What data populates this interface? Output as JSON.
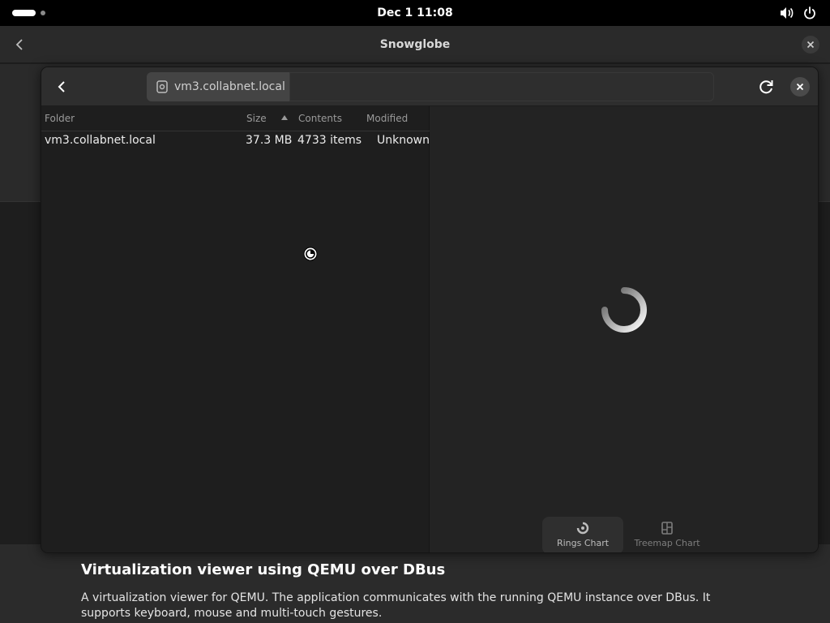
{
  "topbar": {
    "clock": "Dec 1  11:08",
    "icons": [
      "activities-pill",
      "workspace-dot",
      "volume-icon",
      "power-icon"
    ]
  },
  "background_app": {
    "title": "Snowglobe",
    "heading": "Virtualization viewer using QEMU over DBus",
    "description": "A virtualization viewer for QEMU. The application communicates with the running QEMU instance over DBus. It supports keyboard, mouse and multi-touch gestures."
  },
  "window": {
    "path": {
      "crumb_label": "vm3.collabnet.local",
      "icon": "drive-icon"
    },
    "columns": {
      "folder": "Folder",
      "size": "Size",
      "contents": "Contents",
      "modified": "Modified"
    },
    "rows": [
      {
        "folder": "vm3.collabnet.local",
        "size": "37.3 MB",
        "contents": "4733 items",
        "modified": "Unknown"
      }
    ],
    "view_switcher": {
      "rings": "Rings Chart",
      "treemap": "Treemap Chart",
      "selected": "rings"
    }
  },
  "colors": {
    "topbar": "#000000",
    "window_bg": "#242424",
    "list_bg": "#1e1e1e",
    "text": "#ececec"
  }
}
